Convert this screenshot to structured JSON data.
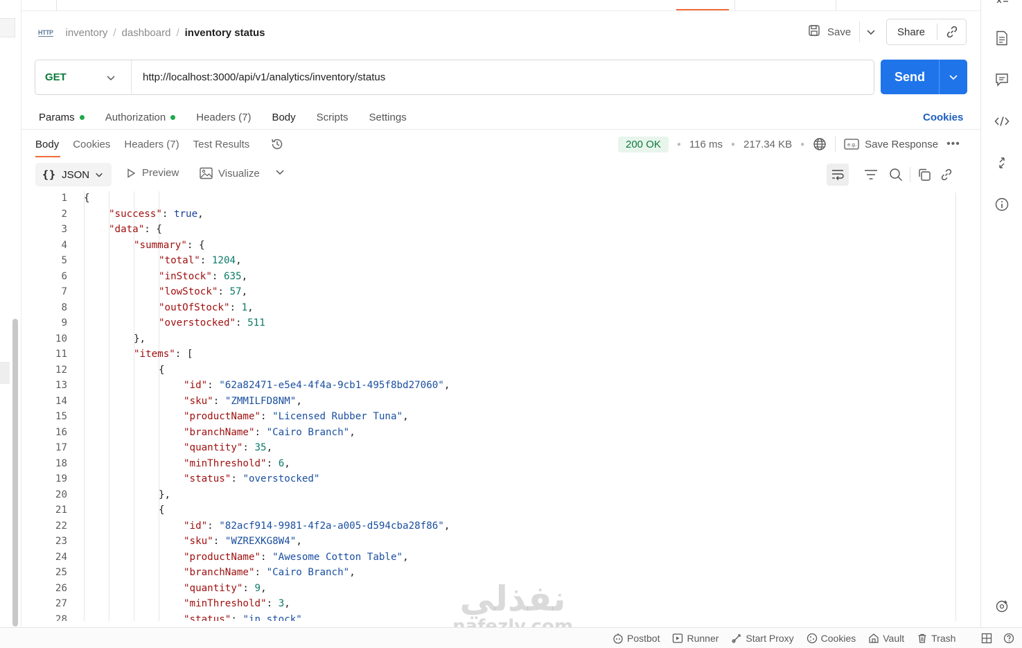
{
  "breadcrumb": {
    "icon": "HTTP",
    "items": [
      "inventory",
      "dashboard"
    ],
    "separator": "/",
    "current": "inventory status"
  },
  "header": {
    "save_label": "Save",
    "share_label": "Share"
  },
  "request": {
    "method": "GET",
    "url": "http://localhost:3000/api/v1/analytics/inventory/status",
    "send_label": "Send"
  },
  "request_tabs": {
    "params": "Params",
    "authorization": "Authorization",
    "headers": "Headers (7)",
    "body": "Body",
    "scripts": "Scripts",
    "settings": "Settings",
    "cookies": "Cookies"
  },
  "response_tabs": {
    "body": "Body",
    "cookies": "Cookies",
    "headers": "Headers (7)",
    "test_results": "Test Results"
  },
  "response_meta": {
    "status": "200 OK",
    "time": "116 ms",
    "size": "217.34 KB",
    "save_response": "Save Response",
    "status_color": "#0b7a3b"
  },
  "viewer": {
    "format": "JSON",
    "preview": "Preview",
    "visualize": "Visualize"
  },
  "code_lines": [
    {
      "n": "1"
    },
    {
      "n": "2"
    },
    {
      "n": "3"
    },
    {
      "n": "4"
    },
    {
      "n": "5"
    },
    {
      "n": "6"
    },
    {
      "n": "7"
    },
    {
      "n": "8"
    },
    {
      "n": "9"
    },
    {
      "n": "10"
    },
    {
      "n": "11"
    },
    {
      "n": "12"
    },
    {
      "n": "13"
    },
    {
      "n": "14"
    },
    {
      "n": "15"
    },
    {
      "n": "16"
    },
    {
      "n": "17"
    },
    {
      "n": "18"
    },
    {
      "n": "19"
    },
    {
      "n": "20"
    },
    {
      "n": "21"
    },
    {
      "n": "22"
    },
    {
      "n": "23"
    },
    {
      "n": "24"
    },
    {
      "n": "25"
    },
    {
      "n": "26"
    },
    {
      "n": "27"
    },
    {
      "n": "28"
    }
  ],
  "json": {
    "success_key": "\"success\"",
    "success_val": "true",
    "data_key": "\"data\"",
    "summary_key": "\"summary\"",
    "total_key": "\"total\"",
    "total_val": "1204",
    "instock_key": "\"inStock\"",
    "instock_val": "635",
    "lowstock_key": "\"lowStock\"",
    "lowstock_val": "57",
    "outofstock_key": "\"outOfStock\"",
    "outofstock_val": "1",
    "overstocked_key": "\"overstocked\"",
    "overstocked_val": "511",
    "items_key": "\"items\"",
    "item1": {
      "id_key": "\"id\"",
      "id_val": "\"62a82471-e5e4-4f4a-9cb1-495f8bd27060\"",
      "sku_key": "\"sku\"",
      "sku_val": "\"ZMMILFD8NM\"",
      "pn_key": "\"productName\"",
      "pn_val": "\"Licensed Rubber Tuna\"",
      "bn_key": "\"branchName\"",
      "bn_val": "\"Cairo Branch\"",
      "qty_key": "\"quantity\"",
      "qty_val": "35",
      "min_key": "\"minThreshold\"",
      "min_val": "6",
      "st_key": "\"status\"",
      "st_val": "\"overstocked\""
    },
    "item2": {
      "id_key": "\"id\"",
      "id_val": "\"82acf914-9981-4f2a-a005-d594cba28f86\"",
      "sku_key": "\"sku\"",
      "sku_val": "\"WZREXKG8W4\"",
      "pn_key": "\"productName\"",
      "pn_val": "\"Awesome Cotton Table\"",
      "bn_key": "\"branchName\"",
      "bn_val": "\"Cairo Branch\"",
      "qty_key": "\"quantity\"",
      "qty_val": "9",
      "min_key": "\"minThreshold\"",
      "min_val": "3",
      "st_key": "\"status\"",
      "st_val": "\"in_stock\""
    }
  },
  "status_bar": {
    "postbot": "Postbot",
    "runner": "Runner",
    "start_proxy": "Start Proxy",
    "cookies": "Cookies",
    "vault": "Vault",
    "trash": "Trash"
  },
  "watermark": {
    "arabic": "نفذلي",
    "latin": "nafezly.com"
  },
  "colors": {
    "accent": "#1f74ea",
    "active_tab": "#f26b3a",
    "key": "#a01010",
    "string": "#1a4fa0",
    "number": "#0b7a6a"
  }
}
